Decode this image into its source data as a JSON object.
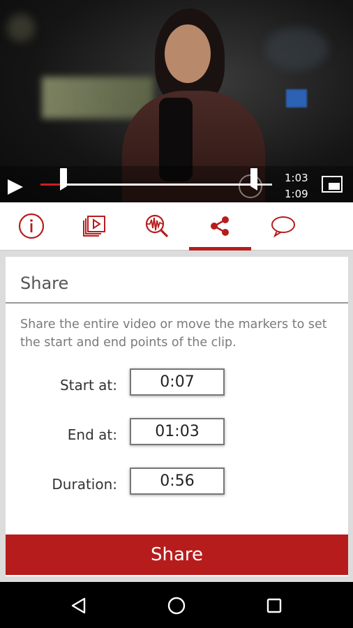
{
  "player": {
    "current_time": "1:03",
    "total_time": "1:09",
    "playback_progress": 0.913,
    "clip_start_fraction": 0.101,
    "clip_end_fraction": 0.913
  },
  "tabs": [
    {
      "icon": "info-icon"
    },
    {
      "icon": "playlist-icon"
    },
    {
      "icon": "audio-search-icon"
    },
    {
      "icon": "share-icon",
      "selected": true
    },
    {
      "icon": "comment-icon"
    }
  ],
  "share_panel": {
    "title": "Share",
    "description": "Share the entire video or move the markers to set the start and end points of the clip.",
    "start_label": "Start at:",
    "start_value": "0:07",
    "end_label": "End at:",
    "end_value": "01:03",
    "duration_label": "Duration:",
    "duration_value": "0:56",
    "share_button": "Share"
  },
  "colors": {
    "accent": "#b71c1c",
    "background": "#dcdcdc"
  },
  "navbar": [
    "back-icon",
    "home-icon",
    "recents-icon"
  ]
}
